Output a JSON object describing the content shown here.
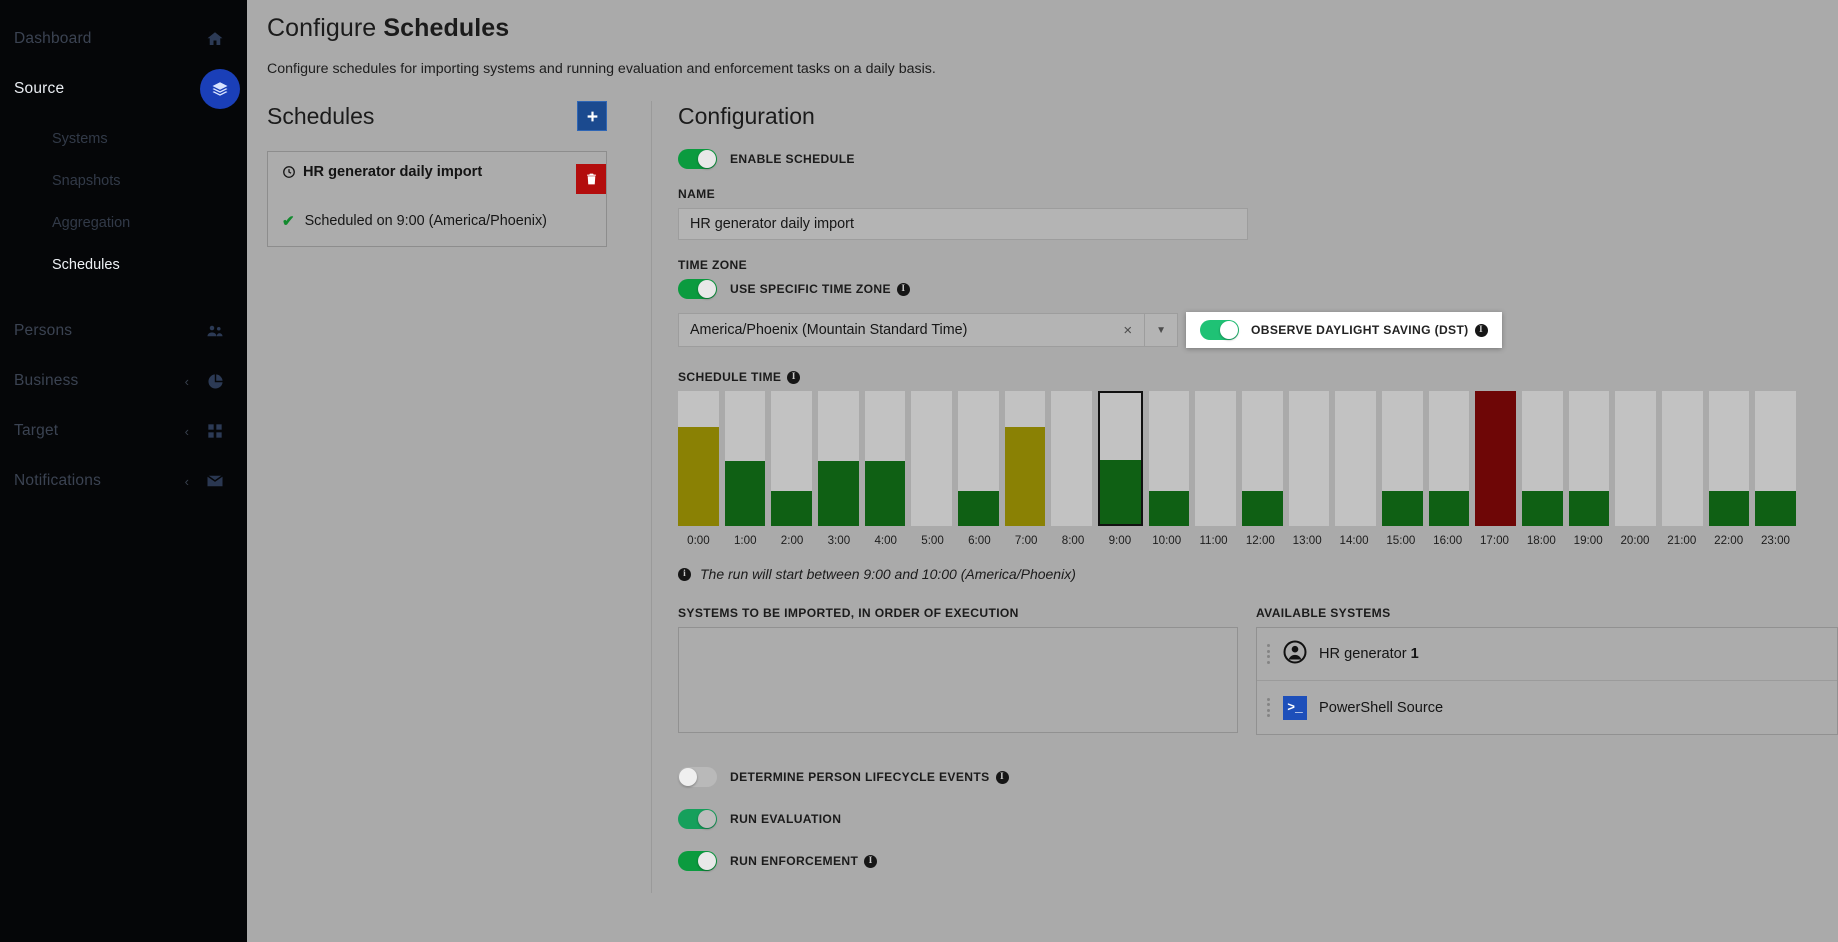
{
  "sidebar": {
    "items": [
      {
        "label": "Dashboard",
        "icon": "home-icon",
        "active": false,
        "chevron": false
      },
      {
        "label": "Source",
        "icon": "layers-icon",
        "active": true,
        "chevron": true
      },
      {
        "label": "Persons",
        "icon": "people-icon",
        "active": false,
        "chevron": false
      },
      {
        "label": "Business",
        "icon": "pie-icon",
        "active": false,
        "chevron": true
      },
      {
        "label": "Target",
        "icon": "grid-icon",
        "active": false,
        "chevron": true
      },
      {
        "label": "Notifications",
        "icon": "envelope-icon",
        "active": false,
        "chevron": true
      }
    ],
    "subitems": [
      {
        "label": "Systems",
        "active": false
      },
      {
        "label": "Snapshots",
        "active": false
      },
      {
        "label": "Aggregation",
        "active": false
      },
      {
        "label": "Schedules",
        "active": true
      }
    ],
    "accent_color": "#1a3fb8"
  },
  "page": {
    "title_prefix": "Configure ",
    "title_strong": "Schedules",
    "subtitle": "Configure schedules for importing systems and running evaluation and enforcement tasks on a daily basis."
  },
  "schedules_panel": {
    "heading": "Schedules",
    "add_label": "+",
    "card": {
      "title": "HR generator daily import",
      "status": "Scheduled on 9:00 (America/Phoenix)",
      "delete_label": "\u0001"
    }
  },
  "configuration": {
    "heading": "Configuration",
    "enable_schedule": {
      "label": "Enable schedule",
      "on": true
    },
    "name": {
      "label": "Name",
      "value": "HR generator daily import"
    },
    "time_zone": {
      "label": "Time zone",
      "use_specific": {
        "label": "Use specific time zone",
        "on": true
      },
      "selected": "America/Phoenix (Mountain Standard Time)",
      "clear_label": "×",
      "caret_label": "▼",
      "dst": {
        "label": "Observe daylight saving (DST)",
        "on": true
      }
    },
    "schedule_time": {
      "label": "Schedule time",
      "hint": "The run will start between 9:00 and 10:00 (America/Phoenix)"
    },
    "systems_to_import": {
      "label": "Systems to be imported, in order of execution",
      "items": []
    },
    "available_systems": {
      "label": "Available systems",
      "items": [
        {
          "name": "HR generator ",
          "suffix": "1",
          "icon": "person-avatar-icon"
        },
        {
          "name": "PowerShell Source",
          "suffix": "",
          "icon": "powershell-icon"
        }
      ]
    },
    "options": [
      {
        "label": "Determine person lifecycle events",
        "on": false,
        "info": true,
        "style": "off"
      },
      {
        "label": "Run evaluation",
        "on": true,
        "info": false,
        "style": "greenish"
      },
      {
        "label": "Run enforcement",
        "on": true,
        "info": true,
        "style": "on"
      }
    ]
  },
  "chart_data": {
    "type": "bar",
    "title": "Schedule time",
    "xlabel": "",
    "ylabel": "",
    "ylim": [
      0,
      100
    ],
    "grid": false,
    "legend": "none",
    "categories": [
      "0:00",
      "1:00",
      "2:00",
      "3:00",
      "4:00",
      "5:00",
      "6:00",
      "7:00",
      "8:00",
      "9:00",
      "10:00",
      "11:00",
      "12:00",
      "13:00",
      "14:00",
      "15:00",
      "16:00",
      "17:00",
      "18:00",
      "19:00",
      "20:00",
      "21:00",
      "22:00",
      "23:00"
    ],
    "values": [
      73,
      48,
      26,
      48,
      48,
      0,
      26,
      73,
      0,
      49,
      26,
      0,
      26,
      0,
      0,
      26,
      26,
      100,
      26,
      26,
      0,
      0,
      26,
      26
    ],
    "bar_colors": [
      "#8a8104",
      "#0f6014",
      "#0f6014",
      "#0f6014",
      "#0f6014",
      "none",
      "#0f6014",
      "#8a8104",
      "none",
      "#0f6014",
      "#0f6014",
      "none",
      "#0f6014",
      "none",
      "none",
      "#0f6014",
      "#0f6014",
      "#6e0606",
      "#0f6014",
      "#0f6014",
      "none",
      "none",
      "#0f6014",
      "#0f6014"
    ],
    "track_color": "#c2c2c2",
    "selected_index": 9,
    "selected_outline": "#111111",
    "color_legend": {
      "green": "#0f6014",
      "olive": "#8a8104",
      "red": "#6e0606"
    }
  }
}
